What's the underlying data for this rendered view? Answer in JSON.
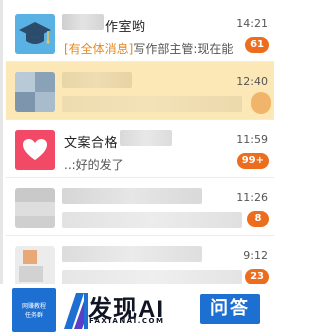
{
  "conversations": [
    {
      "title": "作室哟",
      "time": "14:21",
      "preview_tag": "[有全体消息]",
      "preview_text": "写作部主管:现在能",
      "badge": "61"
    },
    {
      "title": "",
      "time": "12:40",
      "preview_tag": "",
      "preview_text": "",
      "badge": ""
    },
    {
      "title": "文案合格",
      "time": "11:59",
      "preview_tag": "",
      "preview_text": "..:好的发了",
      "badge": "99+"
    },
    {
      "title": "",
      "time": "11:26",
      "preview_tag": "",
      "preview_text": "",
      "badge": "8"
    },
    {
      "title": "",
      "time": "9:12",
      "preview_tag": "",
      "preview_text": "",
      "badge": "23"
    }
  ],
  "watermark": {
    "left_badge_line1": "网赚教程",
    "left_badge_line2": "任务群",
    "brand": "发现AI",
    "domain": "FAXIANAI.COM",
    "qa": "问答"
  },
  "colors": {
    "badge": "#ec6d1e",
    "pinned_row": "#fbe8b6",
    "tag": "#e58a1f",
    "accent_blue": "#1d6fd2"
  }
}
